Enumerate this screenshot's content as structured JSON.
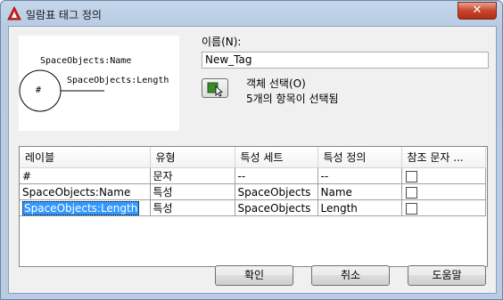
{
  "window": {
    "title": "일람표 태그 정의",
    "close_glyph": "✕"
  },
  "preview": {
    "tag_symbol": "#",
    "name_text": "SpaceObjects:Name",
    "length_text": "SpaceObjects:Length"
  },
  "name_field": {
    "label": "이름(N):",
    "value": "New_Tag"
  },
  "select_objects": {
    "label": "객체 선택(O)",
    "selected_count": "5개의 항목이 선택됨"
  },
  "table": {
    "columns": [
      "레이블",
      "유형",
      "특성 세트",
      "특성 정의",
      "참조 문자 ..."
    ],
    "rows": [
      {
        "label": "#",
        "type": "문자",
        "property_set": "--",
        "property_def": "--",
        "reference_checked": false,
        "selected": false
      },
      {
        "label": "SpaceObjects:Name",
        "type": "특성",
        "property_set": "SpaceObjects",
        "property_def": "Name",
        "reference_checked": false,
        "selected": false
      },
      {
        "label": "SpaceObjects:Length",
        "type": "특성",
        "property_set": "SpaceObjects",
        "property_def": "Length",
        "reference_checked": false,
        "selected": true
      }
    ]
  },
  "buttons": {
    "ok": "확인",
    "cancel": "취소",
    "help": "도움말"
  },
  "colors": {
    "selection": "#3399ff",
    "title_bar": "#b9cce4",
    "close_button": "#c8452c"
  },
  "icons": {
    "app": "autocad-app-icon",
    "select": "select-objects-icon"
  }
}
